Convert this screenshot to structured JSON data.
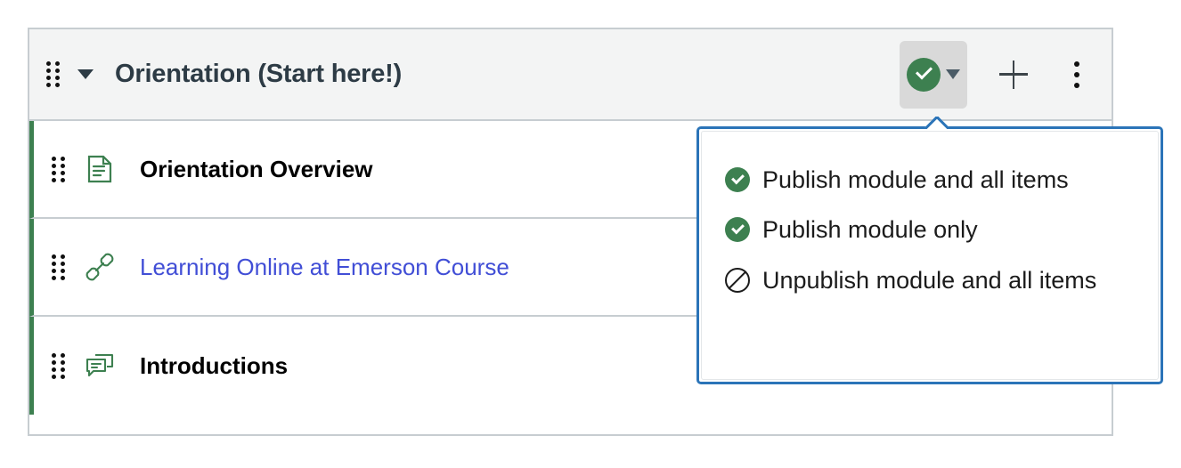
{
  "module": {
    "title": "Orientation (Start here!)",
    "drag_handle_name": "drag-handle",
    "collapse_caret_name": "collapse-caret",
    "header_bg": "#f3f4f4",
    "accent_green": "#3d8050",
    "border_gray": "#c7cdd1",
    "title_color": "#2d3b45",
    "actions": {
      "publish_label": "Published",
      "publish_caret_label": "Publish options",
      "add_label": "Add item",
      "more_label": "Module options"
    }
  },
  "items": [
    {
      "title": "Orientation Overview",
      "icon": "document-icon",
      "is_link": false,
      "show_publish": false,
      "show_kebab": false
    },
    {
      "title": "Learning Online at Emerson Course",
      "icon": "link-icon",
      "is_link": true,
      "show_publish": false,
      "show_kebab": false
    },
    {
      "title": "Introductions",
      "icon": "discussion-icon",
      "is_link": false,
      "show_publish": true,
      "show_kebab": true
    }
  ],
  "dropdown": {
    "border_color": "#2b74b8",
    "items": [
      {
        "label": "Publish module and all items",
        "icon": "published-check-icon"
      },
      {
        "label": "Publish module only",
        "icon": "published-check-icon"
      },
      {
        "label": "Unpublish module and all items",
        "icon": "unpublished-ban-icon"
      }
    ]
  },
  "colors": {
    "link_blue": "#414ed6",
    "icon_green": "#3d8050",
    "text_black": "#000000"
  }
}
